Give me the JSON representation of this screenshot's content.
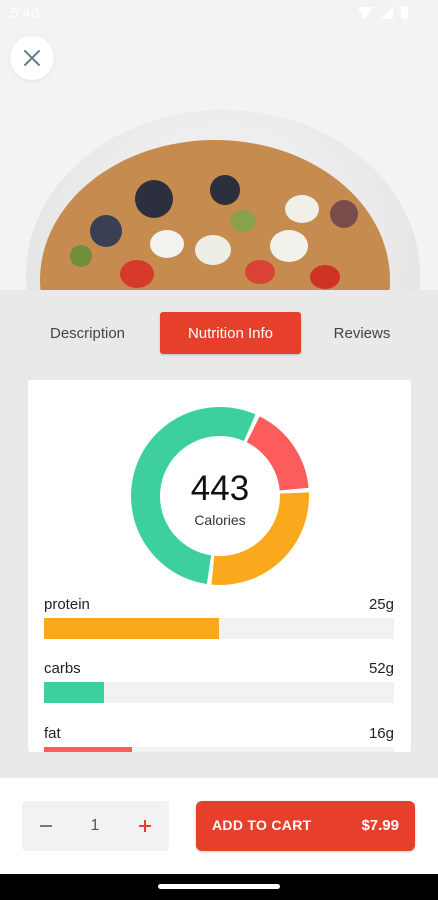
{
  "status_bar": {
    "time": "5:40",
    "icons": [
      "wifi-icon",
      "signal-icon",
      "battery-icon"
    ]
  },
  "header": {
    "close_icon": "close-icon"
  },
  "tabs": [
    {
      "label": "Description",
      "active": false
    },
    {
      "label": "Nutrition Info",
      "active": true
    },
    {
      "label": "Reviews",
      "active": false
    }
  ],
  "nutrition": {
    "calories_value": "443",
    "calories_label": "Calories",
    "macros": [
      {
        "name": "protein",
        "value": "25g",
        "color": "#fba91c",
        "fraction": 0.5
      },
      {
        "name": "carbs",
        "value": "52g",
        "color": "#3ecf9e",
        "fraction": 0.17
      },
      {
        "name": "fat",
        "value": "16g",
        "color": "#fd5c5c",
        "fraction": 0.25
      }
    ],
    "donut_segments": [
      {
        "label": "carbs",
        "color": "#3ecf9e",
        "fraction": 0.55
      },
      {
        "label": "fat",
        "color": "#fd5c5c",
        "fraction": 0.17
      },
      {
        "label": "protein",
        "color": "#fba91c",
        "fraction": 0.28
      }
    ]
  },
  "footer": {
    "quantity": "1",
    "minus_icon": "minus-icon",
    "plus_icon": "plus-icon",
    "add_to_cart_label": "ADD TO CART",
    "price": "$7.99"
  },
  "colors": {
    "accent": "#e63f2b",
    "background": "#e9e9e9"
  }
}
